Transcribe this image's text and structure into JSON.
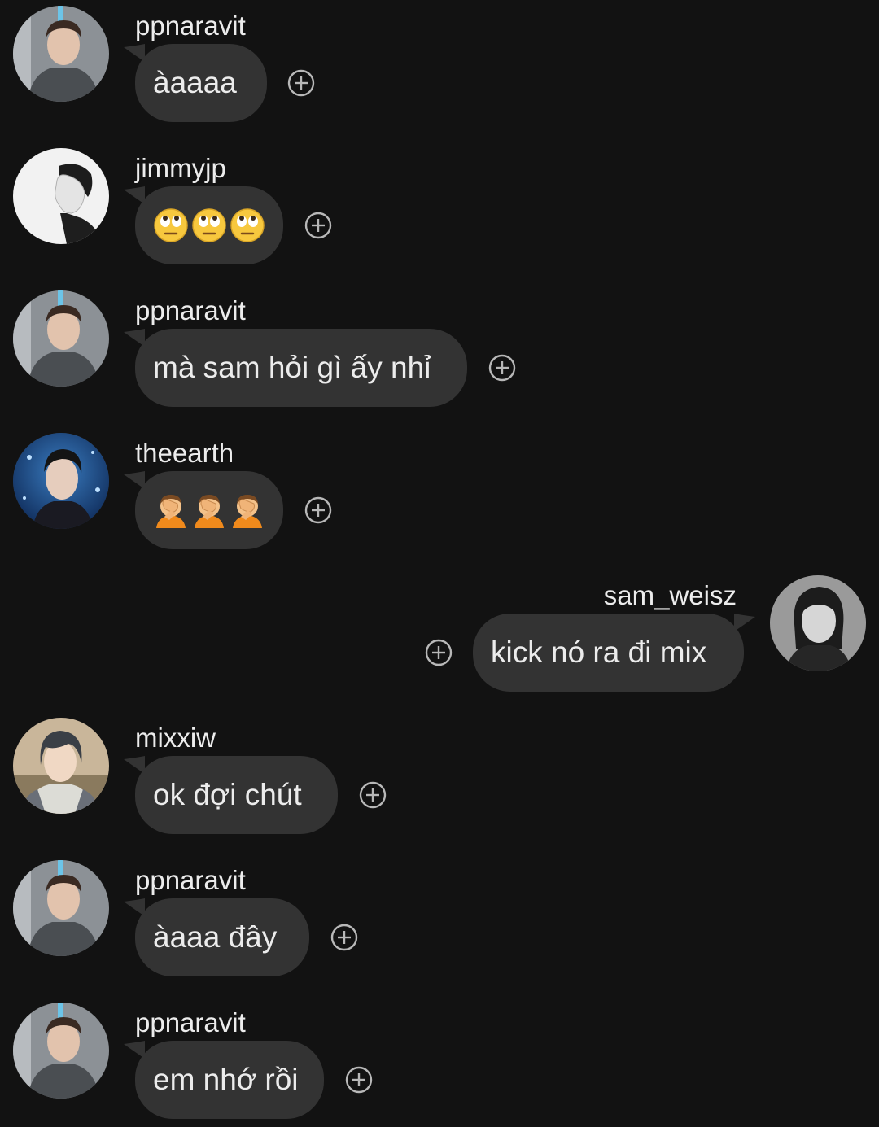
{
  "messages": [
    {
      "username": "ppnaravit",
      "text": "àaaaa",
      "side": "left",
      "avatar": "avatar-ppnaravit"
    },
    {
      "username": "jimmyjp",
      "text": "🙄🙄🙄",
      "emoji": "face-with-rolling-eyes",
      "side": "left",
      "avatar": "avatar-jimmyjp"
    },
    {
      "username": "ppnaravit",
      "text": "mà sam hỏi gì ấy nhỉ",
      "side": "left",
      "avatar": "avatar-ppnaravit"
    },
    {
      "username": "theearth",
      "text": "🤦🤦🤦",
      "emoji": "person-facepalming",
      "side": "left",
      "avatar": "avatar-theearth"
    },
    {
      "username": "sam_weisz",
      "text": "kick nó ra đi mix",
      "side": "right",
      "avatar": "avatar-sam-weisz"
    },
    {
      "username": "mixxiw",
      "text": "ok đợi chút",
      "side": "left",
      "avatar": "avatar-mixxiw"
    },
    {
      "username": "ppnaravit",
      "text": "àaaa đây",
      "side": "left",
      "avatar": "avatar-ppnaravit"
    },
    {
      "username": "ppnaravit",
      "text": "em nhớ rồi",
      "side": "left",
      "avatar": "avatar-ppnaravit"
    }
  ],
  "icons": {
    "add_reaction": "plus-circle-icon"
  },
  "colors": {
    "background": "#121212",
    "bubble": "#333333",
    "text": "#ececec",
    "icon": "#b8b8b8"
  }
}
